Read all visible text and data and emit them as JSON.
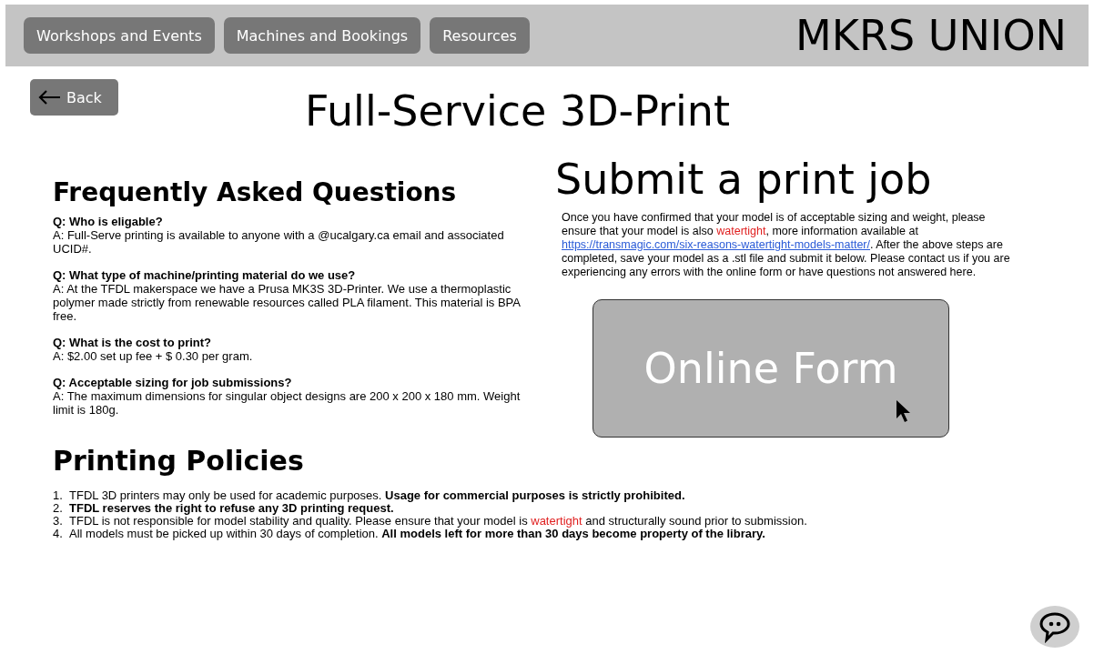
{
  "nav": {
    "links": [
      "Workshops and Events",
      "Machines and Bookings",
      "Resources"
    ],
    "logo": "MKRS UNION"
  },
  "back": {
    "label": "Back"
  },
  "title": "Full-Service 3D-Print",
  "faq": {
    "heading": "Frequently Asked Questions",
    "items": [
      {
        "question": "Q: Who is eligable?",
        "answer": "A: Full-Serve printing is available to anyone with a @ucalgary.ca email and associated UCID#."
      },
      {
        "question": "Q: What type of machine/printing material do we use?",
        "answer": "A: At the TFDL makerspace we have a Prusa MK3S 3D-Printer. We use a thermoplastic polymer made strictly from renewable resources called PLA filament. This material is BPA free."
      },
      {
        "question": "Q: What is the cost to print?",
        "answer": "A: $2.00 set up fee + $ 0.30 per gram."
      },
      {
        "question": "Q: Acceptable sizing for job submissions?",
        "answer": "A: The maximum dimensions for singular object designs are 200 x 200 x 180 mm. Weight limit is 180g."
      }
    ]
  },
  "submit": {
    "heading": "Submit a print job",
    "paragraph": [
      {
        "kind": "plain",
        "text": "Once you have confirmed that your model is of acceptable sizing and weight, please ensure that your model is also "
      },
      {
        "kind": "alert",
        "text": "watertight"
      },
      {
        "kind": "plain",
        "text": ", more information available at "
      },
      {
        "kind": "link",
        "text": "https://transmagic.com/six-reasons-watertight-models-matter/"
      },
      {
        "kind": "plain",
        "text": ". After the above steps are completed, save your model as a .stl file and submit it below. Please contact us if you are experiencing any errors with the online form or have questions not answered here."
      }
    ],
    "form_button": "Online Form"
  },
  "policies": {
    "heading": "Printing Policies",
    "items": [
      {
        "number": "1.",
        "parts": [
          {
            "kind": "plain",
            "text": "TFDL 3D printers may only be used for academic purposes. "
          },
          {
            "kind": "bold",
            "text": "Usage for commercial purposes is strictly prohibited."
          }
        ]
      },
      {
        "number": "2.",
        "parts": [
          {
            "kind": "bold",
            "text": "TFDL reserves the right to refuse any 3D printing request."
          }
        ]
      },
      {
        "number": "3.",
        "parts": [
          {
            "kind": "plain",
            "text": "TFDL is not responsible for model stability and quality. Please ensure that your model is "
          },
          {
            "kind": "alert",
            "text": "watertight"
          },
          {
            "kind": "plain",
            "text": " and structurally sound prior to submission."
          }
        ]
      },
      {
        "number": "4.",
        "parts": [
          {
            "kind": "plain",
            "text": "All models must be picked up within 30 days of completion. "
          },
          {
            "kind": "bold",
            "text": "All models left for more than 30 days become property of the library."
          }
        ]
      }
    ]
  }
}
